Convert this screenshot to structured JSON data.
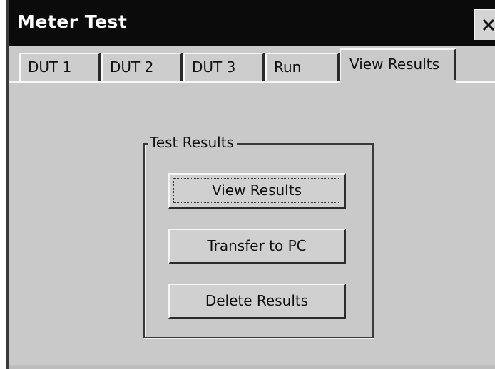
{
  "window": {
    "title": "Meter Test",
    "close_icon": "close-icon"
  },
  "tabs": [
    {
      "label": "DUT 1",
      "active": false
    },
    {
      "label": "DUT 2",
      "active": false
    },
    {
      "label": "DUT 3",
      "active": false
    },
    {
      "label": "Run",
      "active": false
    },
    {
      "label": "View Results",
      "active": true
    }
  ],
  "results_group": {
    "title": "Test Results",
    "buttons": {
      "view": "View Results",
      "transfer": "Transfer to PC",
      "delete": "Delete Results"
    }
  },
  "colors": {
    "titlebar": "#0b0b0b",
    "face": "#c9c9c9",
    "shadow": "#2b2b2b",
    "highlight": "#f6f6f6"
  }
}
